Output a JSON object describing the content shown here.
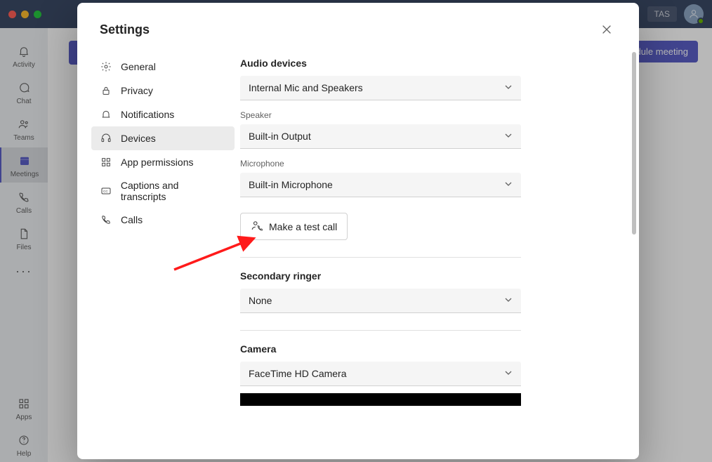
{
  "window": {
    "user_initials": "TAS",
    "schedule_button": "dule meeting"
  },
  "left_rail": {
    "activity": "Activity",
    "chat": "Chat",
    "teams": "Teams",
    "meetings": "Meetings",
    "calls": "Calls",
    "files": "Files",
    "apps": "Apps",
    "help": "Help"
  },
  "modal": {
    "title": "Settings",
    "nav": {
      "general": "General",
      "privacy": "Privacy",
      "notifications": "Notifications",
      "devices": "Devices",
      "app_permissions": "App permissions",
      "captions": "Captions and transcripts",
      "calls": "Calls"
    },
    "content": {
      "audio_devices_title": "Audio devices",
      "audio_device_value": "Internal Mic and Speakers",
      "speaker_label": "Speaker",
      "speaker_value": "Built-in Output",
      "microphone_label": "Microphone",
      "microphone_value": "Built-in Microphone",
      "test_call_label": "Make a test call",
      "secondary_ringer_title": "Secondary ringer",
      "secondary_ringer_value": "None",
      "camera_title": "Camera",
      "camera_value": "FaceTime HD Camera"
    }
  }
}
